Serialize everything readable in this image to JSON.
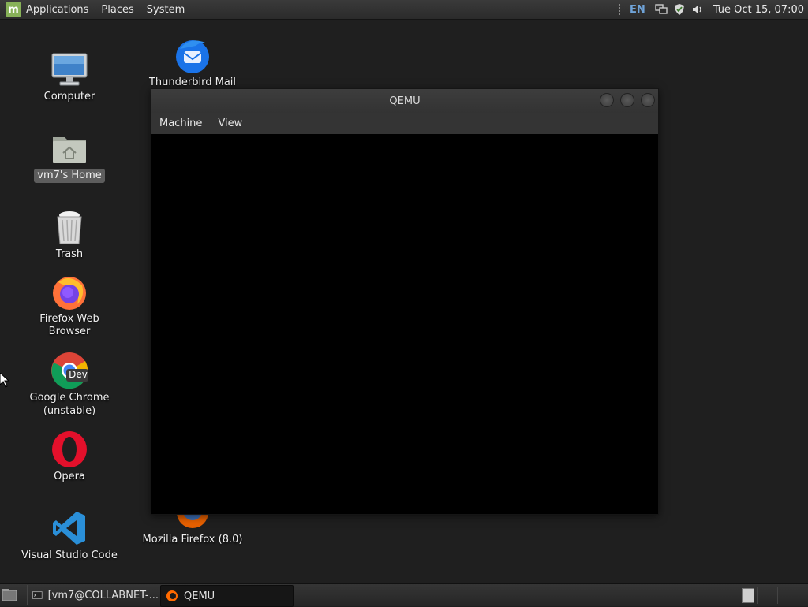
{
  "top_panel": {
    "menus": [
      "Applications",
      "Places",
      "System"
    ],
    "keyboard_layout": "EN",
    "clock": "Tue Oct 15, 07:00"
  },
  "desktop_icons": {
    "computer": "Computer",
    "home": "vm7's Home",
    "trash": "Trash",
    "firefox": "Firefox Web Browser",
    "chrome_line1": "Google Chrome",
    "chrome_line2": "(unstable)",
    "chrome_badge": "Dev",
    "opera": "Opera",
    "vscode": "Visual Studio Code",
    "thunderbird": "Thunderbird Mail",
    "mozilla_firefox": "Mozilla Firefox (8.0)"
  },
  "window": {
    "title": "QEMU",
    "menus": [
      "Machine",
      "View"
    ]
  },
  "taskbar": {
    "tasks": [
      "[vm7@COLLABNET-...",
      "QEMU"
    ],
    "active_task": "QEMU"
  },
  "colors": {
    "mint_green": "#87b158",
    "tray_blue": "#6fa3d8",
    "desktop_bg": "#1f1f1f"
  }
}
